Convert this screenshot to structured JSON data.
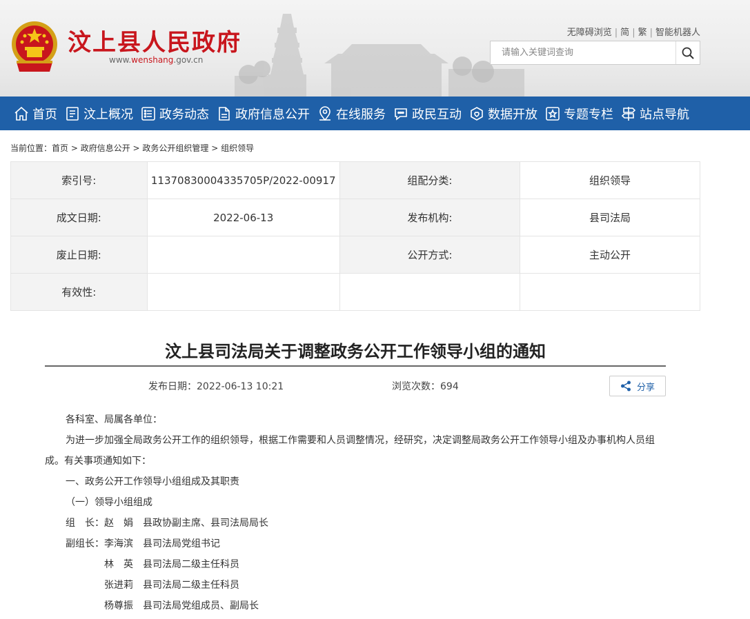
{
  "header": {
    "site_name": "汶上县人民政府",
    "domain_prefix": "www.",
    "domain_main": "wenshang",
    "domain_suffix": ".gov.cn",
    "top_links": [
      "无障碍浏览",
      "简",
      "繁",
      "智能机器人"
    ],
    "search_placeholder": "请输入关键词查询"
  },
  "nav": {
    "items": [
      {
        "label": "首页",
        "icon": "home-icon"
      },
      {
        "label": "汶上概况",
        "icon": "document-icon"
      },
      {
        "label": "政务动态",
        "icon": "list-icon"
      },
      {
        "label": "政府信息公开",
        "icon": "file-icon"
      },
      {
        "label": "在线服务",
        "icon": "location-icon"
      },
      {
        "label": "政民互动",
        "icon": "chat-icon"
      },
      {
        "label": "数据开放",
        "icon": "data-icon"
      },
      {
        "label": "专题专栏",
        "icon": "star-icon"
      },
      {
        "label": "站点导航",
        "icon": "signpost-icon"
      }
    ],
    "background": "#1f60a8"
  },
  "breadcrumb": {
    "prefix": "当前位置：",
    "items": [
      "首页",
      "政府信息公开",
      "政务公开组织管理",
      "组织领导"
    ],
    "separator": " > "
  },
  "meta": {
    "index_no_label": "索引号:",
    "index_no_value": "11370830004335705P/2022-00917",
    "category_label": "组配分类:",
    "category_value": "组织领导",
    "date_label": "成文日期:",
    "date_value": "2022-06-13",
    "publisher_label": "发布机构:",
    "publisher_value": "县司法局",
    "expire_label": "废止日期:",
    "expire_value": "",
    "method_label": "公开方式:",
    "method_value": "主动公开",
    "validity_label": "有效性:",
    "validity_value": ""
  },
  "article": {
    "title": "汶上县司法局关于调整政务公开工作领导小组的通知",
    "publish_label": "发布日期：",
    "publish_value": "2022-06-13 10:21",
    "views_label": "浏览次数：",
    "views_value": "694",
    "share_label": "分享",
    "paragraphs": [
      "各科室、局属各单位：",
      "为进一步加强全局政务公开工作的组织领导，根据工作需要和人员调整情况，经研究，决定调整局政务公开工作领导小组及办事机构人员组成。有关事项通知如下：",
      "一、政务公开工作领导小组组成及其职责",
      "（一）领导小组组成",
      "组　长：赵　娟　县政协副主席、县司法局局长",
      "副组长：李海滨　县司法局党组书记",
      "林　英　县司法局二级主任科员",
      "张进莉　县司法局二级主任科员",
      "杨尊振　县司法局党组成员、副局长"
    ]
  }
}
